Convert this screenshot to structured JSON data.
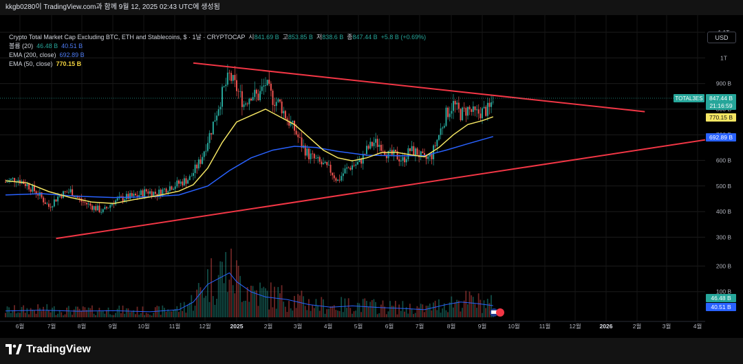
{
  "header": {
    "caption": "kkgb0280이 TradingView.com과 함께 9월 12, 2025 02:43 UTC에 생성됨"
  },
  "legend": {
    "title": "Crypto Total Market Cap Excluding BTC, ETH and Stablecoins, $ · 1날 · CRYPTOCAP",
    "open_label": "시",
    "open_value": "841.69 B",
    "high_label": "고",
    "high_value": "853.85 B",
    "low_label": "저",
    "low_value": "838.6 B",
    "close_label": "종",
    "close_value": "847.44 B",
    "change": "+5.8 B (+0.69%)",
    "volume_label": "볼륨 (20)",
    "volume_v1": "46.48 B",
    "volume_v2": "40.51 B",
    "ema200_label": "EMA (200, close)",
    "ema200_value": "692.89 B",
    "ema50_label": "EMA (50, close)",
    "ema50_value": "770.15 B"
  },
  "currency_button": "USD",
  "brand": {
    "name": "TradingView"
  },
  "price_tags": {
    "symbol": "TOTAL3ES",
    "price": "847.44 B",
    "countdown": "21:16:59",
    "ema50": "770.15 B",
    "ema200": "692.89 B",
    "vol1": "46.48 B",
    "vol2": "40.51 B"
  },
  "colors": {
    "up": "#26a69a",
    "down": "#ef5350",
    "ema50": "#f5e663",
    "ema200": "#2962ff",
    "trendline": "#f23645",
    "volume_ma": "#2962ff"
  },
  "chart_data": {
    "type": "candlestick",
    "y_axis_ticks": [
      "1.1T",
      "1T",
      "900 B",
      "800 B",
      "700 B",
      "600 B",
      "500 B",
      "400 B",
      "300 B",
      "200 B",
      "100 B"
    ],
    "x_axis_ticks": [
      "6월",
      "7월",
      "8월",
      "9월",
      "10월",
      "11월",
      "12월",
      "2025",
      "2월",
      "3월",
      "4월",
      "5월",
      "6월",
      "7월",
      "8월",
      "9월",
      "10월",
      "11월",
      "12월",
      "2026",
      "2월",
      "3월",
      "4월"
    ],
    "ylim": [
      0,
      1150
    ],
    "price_path": [
      [
        0,
        515
      ],
      [
        3,
        530
      ],
      [
        6,
        505
      ],
      [
        9,
        470
      ],
      [
        12,
        420
      ],
      [
        15,
        465
      ],
      [
        18,
        480
      ],
      [
        21,
        440
      ],
      [
        24,
        420
      ],
      [
        27,
        400
      ],
      [
        30,
        440
      ],
      [
        33,
        455
      ],
      [
        36,
        460
      ],
      [
        39,
        480
      ],
      [
        42,
        470
      ],
      [
        45,
        495
      ],
      [
        48,
        510
      ],
      [
        51,
        530
      ],
      [
        54,
        600
      ],
      [
        57,
        720
      ],
      [
        60,
        860
      ],
      [
        62,
        930
      ],
      [
        64,
        880
      ],
      [
        66,
        820
      ],
      [
        68,
        860
      ],
      [
        70,
        850
      ],
      [
        72,
        900
      ],
      [
        74,
        840
      ],
      [
        76,
        820
      ],
      [
        78,
        760
      ],
      [
        80,
        720
      ],
      [
        82,
        660
      ],
      [
        84,
        620
      ],
      [
        86,
        600
      ],
      [
        88,
        580
      ],
      [
        90,
        560
      ],
      [
        92,
        520
      ],
      [
        94,
        560
      ],
      [
        96,
        580
      ],
      [
        98,
        590
      ],
      [
        100,
        640
      ],
      [
        102,
        670
      ],
      [
        104,
        660
      ],
      [
        106,
        620
      ],
      [
        108,
        620
      ],
      [
        110,
        600
      ],
      [
        112,
        640
      ],
      [
        114,
        630
      ],
      [
        116,
        600
      ],
      [
        118,
        620
      ],
      [
        120,
        700
      ],
      [
        122,
        780
      ],
      [
        124,
        820
      ],
      [
        126,
        780
      ],
      [
        128,
        800
      ],
      [
        130,
        780
      ],
      [
        132,
        790
      ],
      [
        134,
        800
      ],
      [
        135,
        847
      ]
    ],
    "ema50_path": [
      [
        0,
        520
      ],
      [
        6,
        512
      ],
      [
        12,
        478
      ],
      [
        18,
        455
      ],
      [
        24,
        437
      ],
      [
        30,
        432
      ],
      [
        36,
        448
      ],
      [
        42,
        462
      ],
      [
        48,
        480
      ],
      [
        52,
        505
      ],
      [
        56,
        570
      ],
      [
        60,
        670
      ],
      [
        64,
        750
      ],
      [
        68,
        775
      ],
      [
        72,
        800
      ],
      [
        76,
        770
      ],
      [
        80,
        740
      ],
      [
        84,
        690
      ],
      [
        88,
        640
      ],
      [
        92,
        610
      ],
      [
        96,
        598
      ],
      [
        100,
        610
      ],
      [
        104,
        630
      ],
      [
        108,
        632
      ],
      [
        112,
        622
      ],
      [
        116,
        614
      ],
      [
        120,
        650
      ],
      [
        124,
        700
      ],
      [
        128,
        740
      ],
      [
        132,
        755
      ],
      [
        135,
        770
      ]
    ],
    "ema200_path": [
      [
        0,
        465
      ],
      [
        10,
        470
      ],
      [
        20,
        460
      ],
      [
        30,
        455
      ],
      [
        40,
        458
      ],
      [
        48,
        465
      ],
      [
        56,
        500
      ],
      [
        62,
        560
      ],
      [
        68,
        610
      ],
      [
        74,
        640
      ],
      [
        80,
        655
      ],
      [
        86,
        650
      ],
      [
        92,
        635
      ],
      [
        100,
        620
      ],
      [
        108,
        618
      ],
      [
        116,
        618
      ],
      [
        122,
        640
      ],
      [
        128,
        665
      ],
      [
        135,
        693
      ]
    ],
    "trendlines": [
      {
        "name": "upper",
        "from": [
          52,
          980
        ],
        "to": [
          177,
          790
        ]
      },
      {
        "name": "lower",
        "from": [
          14,
          295
        ],
        "to": [
          195,
          680
        ]
      }
    ],
    "volume_ma_path": [
      [
        0,
        25
      ],
      [
        10,
        28
      ],
      [
        20,
        24
      ],
      [
        30,
        26
      ],
      [
        40,
        22
      ],
      [
        48,
        30
      ],
      [
        52,
        60
      ],
      [
        56,
        130
      ],
      [
        60,
        160
      ],
      [
        62,
        175
      ],
      [
        64,
        140
      ],
      [
        68,
        100
      ],
      [
        72,
        80
      ],
      [
        78,
        70
      ],
      [
        84,
        50
      ],
      [
        90,
        40
      ],
      [
        96,
        45
      ],
      [
        104,
        38
      ],
      [
        110,
        35
      ],
      [
        116,
        30
      ],
      [
        122,
        50
      ],
      [
        126,
        60
      ],
      [
        130,
        55
      ],
      [
        135,
        46
      ]
    ]
  }
}
